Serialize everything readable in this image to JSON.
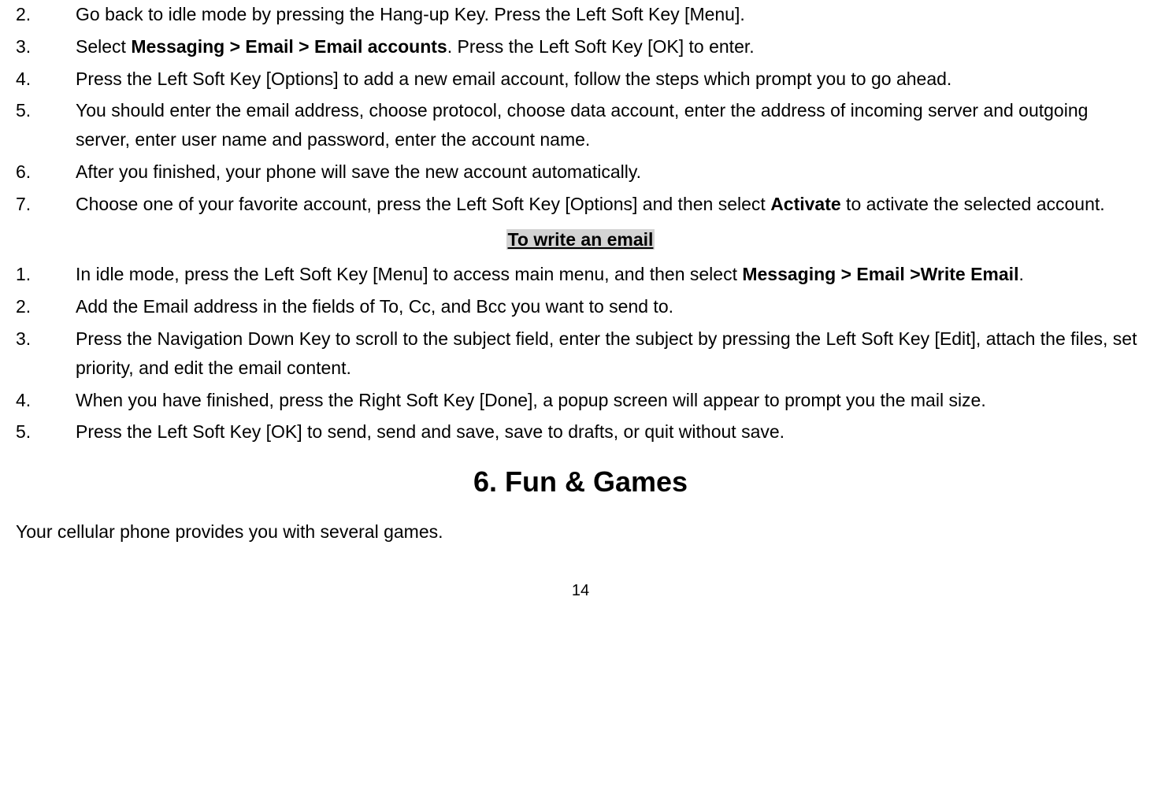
{
  "listA": {
    "items": [
      {
        "num": "2.",
        "parts": [
          {
            "text": "Go back to idle mode by pressing the Hang-up Key. Press the Left Soft Key [Menu].",
            "bold": false
          }
        ]
      },
      {
        "num": "3.",
        "parts": [
          {
            "text": "Select ",
            "bold": false
          },
          {
            "text": "Messaging > Email > Email accounts",
            "bold": true
          },
          {
            "text": ". Press the Left Soft Key [OK] to enter.",
            "bold": false
          }
        ]
      },
      {
        "num": "4.",
        "parts": [
          {
            "text": "Press the Left Soft Key [Options] to add a new email account, follow the steps which prompt you to go ahead.",
            "bold": false
          }
        ]
      },
      {
        "num": "5.",
        "parts": [
          {
            "text": "You should enter the email address, choose protocol, choose data account, enter the address of incoming server and outgoing server, enter user name and password, enter the account name.",
            "bold": false
          }
        ]
      },
      {
        "num": "6.",
        "parts": [
          {
            "text": "After you finished, your phone will save the new account automatically.",
            "bold": false
          }
        ]
      },
      {
        "num": "7.",
        "parts": [
          {
            "text": "Choose one of your favorite account, press the Left Soft Key [Options] and then select ",
            "bold": false
          },
          {
            "text": "Activate",
            "bold": true
          },
          {
            "text": " to activate the selected account.",
            "bold": false
          }
        ]
      }
    ]
  },
  "sectionHeading1": "To write an email",
  "listB": {
    "items": [
      {
        "num": "1.",
        "parts": [
          {
            "text": "In idle mode, press the Left Soft Key [Menu] to access main menu, and then select ",
            "bold": false
          },
          {
            "text": "Messaging > Email >Write Email",
            "bold": true
          },
          {
            "text": ".",
            "bold": false
          }
        ]
      },
      {
        "num": "2.",
        "parts": [
          {
            "text": "Add the Email address in the fields of To, Cc, and Bcc you want to send to.",
            "bold": false
          }
        ]
      },
      {
        "num": "3.",
        "parts": [
          {
            "text": "Press the Navigation Down Key to scroll to the subject field, enter the subject by pressing the Left Soft Key [Edit], attach the files, set priority, and edit the email content.",
            "bold": false
          }
        ]
      },
      {
        "num": "4.",
        "parts": [
          {
            "text": "When you have finished, press the Right Soft Key [Done], a popup screen will appear to prompt you the mail size.",
            "bold": false
          }
        ]
      },
      {
        "num": "5.",
        "parts": [
          {
            "text": "Press the Left Soft Key [OK] to send, send and save, save to drafts, or quit without save.",
            "bold": false
          }
        ]
      }
    ]
  },
  "chapterHeading": "6.    Fun & Games",
  "bodyPara": "Your cellular phone provides you with several games.",
  "pageNumber": "14"
}
